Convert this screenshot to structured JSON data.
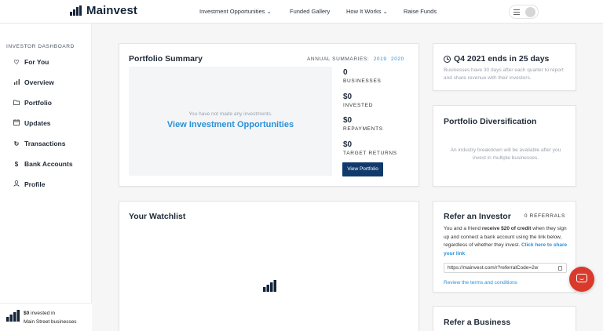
{
  "header": {
    "brand": "Mainvest",
    "nav": [
      {
        "label": "Investment Opportunities ⌄"
      },
      {
        "label": "Funded Gallery"
      },
      {
        "label": "How It Works ⌄"
      },
      {
        "label": "Raise Funds"
      }
    ],
    "menu_icon": "hamburger-icon",
    "avatar_icon": "user-avatar"
  },
  "sidebar": {
    "heading": "INVESTOR DASHBOARD",
    "items": [
      {
        "label": "For You",
        "icon": "heart-icon"
      },
      {
        "label": "Overview",
        "icon": "bar-chart-icon"
      },
      {
        "label": "Portfolio",
        "icon": "folder-icon"
      },
      {
        "label": "Updates",
        "icon": "calendar-icon"
      },
      {
        "label": "Transactions",
        "icon": "refresh-icon"
      },
      {
        "label": "Bank Accounts",
        "icon": "dollar-icon"
      },
      {
        "label": "Profile",
        "icon": "person-icon"
      }
    ],
    "footer": {
      "amount": "$0",
      "invested_in": "invested in",
      "main_street": "Main Street businesses"
    }
  },
  "portfolio_summary": {
    "title": "Portfolio Summary",
    "annual_label": "ANNUAL SUMMARIES:",
    "years": [
      "2019",
      "2020"
    ],
    "empty_message": "You have not made any investments.",
    "empty_link": "View Investment Opportunities",
    "stats": [
      {
        "value": "0",
        "label": "BUSINESSES"
      },
      {
        "value": "$0",
        "label": "INVESTED"
      },
      {
        "value": "$0",
        "label": "REPAYMENTS"
      },
      {
        "value": "$0",
        "label": "TARGET RETURNS"
      }
    ],
    "button": "View Portfolio"
  },
  "quarter": {
    "title": "Q4 2021 ends in 25 days",
    "description": "Businesses have 30 days after each quarter to report and share revenue with their investors.",
    "icon": "clock-icon"
  },
  "diversification": {
    "title": "Portfolio Diversification",
    "description": "An industry breakdown will be available after you invest in multiple businesses."
  },
  "watchlist": {
    "title": "Your Watchlist",
    "loading_icon": "mainvest-logo-icon"
  },
  "referral": {
    "title": "Refer an Investor",
    "count": "0 REFERRALS",
    "text_1": "You and a friend ",
    "text_bold": "receive $20 of credit",
    "text_2": " when they sign up and connect a bank account using the link below, regardless of whether they invest. ",
    "text_link": "Click here to share your link",
    "link_value": "https://mainvest.com/r?referralCode=2w",
    "copy_icon": "copy-icon",
    "terms": "Review the terms and conditions"
  },
  "refer_business": {
    "title": "Refer a Business"
  },
  "chat": {
    "icon": "chat-bubble-icon"
  },
  "colors": {
    "accent_blue": "#2a90d8",
    "button_navy": "#0f3a6b",
    "chat_red": "#d93a2b"
  }
}
